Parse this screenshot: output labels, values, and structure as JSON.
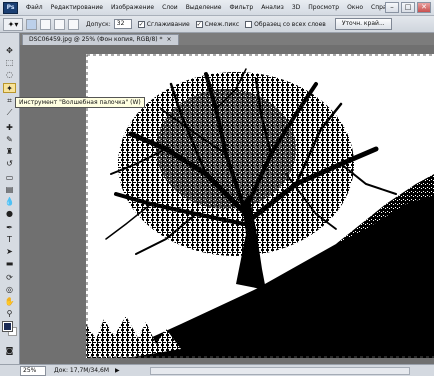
{
  "app": {
    "logo": "Ps",
    "menu": [
      "Файл",
      "Редактирование",
      "Изображение",
      "Слои",
      "Выделение",
      "Фильтр",
      "Анализ",
      "3D",
      "Просмотр",
      "Окно",
      "Справка"
    ],
    "window_controls": [
      "–",
      "□",
      "✕"
    ]
  },
  "options": {
    "tolerance_label": "Допуск:",
    "tolerance_value": "32",
    "antialias_label": "Сглаживание",
    "antialias_checked": "✓",
    "contiguous_label": "Смеж.пикс",
    "contiguous_checked": "✓",
    "sample_all_label": "Образец со всех слоев",
    "refine_button": "Уточн. край..."
  },
  "document": {
    "tab_title": "DSC06459.jpg @ 25% (Фон копия, RGB/8) *",
    "close": "×"
  },
  "tooltip": "Инструмент \"Волшебная палочка\" (W)",
  "status": {
    "zoom": "25%",
    "doc_info": "Док: 17,7М/34,6М",
    "arrow": "▶"
  },
  "icons": {
    "tool_icon": "magic-wand-icon",
    "move": "move-icon",
    "marquee": "marquee-icon",
    "lasso": "lasso-icon",
    "magic_wand": "magic-wand-icon",
    "crop": "crop-icon",
    "eyedropper": "eyedropper-icon",
    "healing": "healing-brush-icon",
    "brush": "brush-icon",
    "stamp": "clone-stamp-icon",
    "history_brush": "history-brush-icon",
    "eraser": "eraser-icon",
    "gradient": "gradient-icon",
    "blur": "blur-icon",
    "dodge": "dodge-icon",
    "pen": "pen-icon",
    "type": "type-icon",
    "path_select": "path-selection-icon",
    "shape": "shape-icon",
    "3d_rotate": "3d-rotate-icon",
    "3d_orbit": "3d-orbit-icon",
    "hand": "hand-icon",
    "zoom": "zoom-icon",
    "quick_mask": "quick-mask-icon"
  },
  "colors": {
    "foreground": "#1a2a55",
    "background": "#ffffff",
    "canvas_surround": "#707070"
  }
}
